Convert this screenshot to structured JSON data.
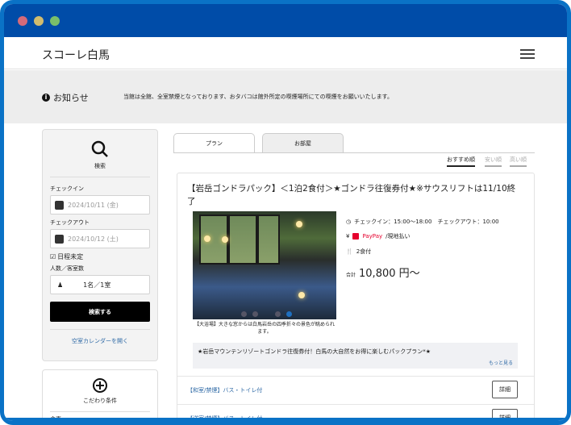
{
  "window": {
    "dots": [
      "#d46a7a",
      "#d1bc6e",
      "#79bf6a"
    ]
  },
  "header": {
    "title": "スコーレ白馬"
  },
  "notice": {
    "label": "お知らせ",
    "message": "当館は全館、全室禁煙となっております、おタバコは館外所定の喫煙場所にての喫煙をお願いいたします。"
  },
  "search": {
    "title": "検索",
    "checkin_label": "チェックイン",
    "checkin_value": "2024/10/11 (金)",
    "checkout_label": "チェックアウト",
    "checkout_value": "2024/10/12 (土)",
    "undecided_label": "日程未定",
    "guests_label": "人数／客室数",
    "guests_value": "1名／1室",
    "search_button": "検索する",
    "calendar_link": "空室カレンダーを開く"
  },
  "filters": {
    "title": "こだわり条件",
    "first_item": "食事"
  },
  "tabs": [
    {
      "label": "プラン",
      "active": true
    },
    {
      "label": "お部屋",
      "active": false
    }
  ],
  "sort": [
    {
      "label": "おすすめ順",
      "active": true
    },
    {
      "label": "安い順",
      "active": false
    },
    {
      "label": "高い順",
      "active": false
    }
  ],
  "plan": {
    "title": "【岩岳ゴンドラパック】＜1泊2食付＞★ゴンドラ往復券付★※サウスリフトは11/10終了",
    "photo_caption": "【大浴場】大きな窓からは白馬岩岳の四季折々の景色が眺められます。",
    "checkin_info": "チェックイン：15:00〜18:00　チェックアウト：10:00",
    "payment_paypay": "PayPay",
    "payment_rest": "/現地払い",
    "meals": "2食付",
    "price_label": "合計",
    "price": "10,800 円〜",
    "description": "★岩岳マウンテンリゾートゴンドラ往復券付！白馬の大自然をお得に楽しむパックプラン*★",
    "more_link": "もっと見る",
    "carousel": {
      "count": 4,
      "active": 4
    }
  },
  "rooms": [
    {
      "name": "【和室/禁煙】バス・トイレ付",
      "button": "詳細"
    },
    {
      "name": "【洋室/禁煙】バス・トイレ付",
      "button": "詳細"
    }
  ]
}
